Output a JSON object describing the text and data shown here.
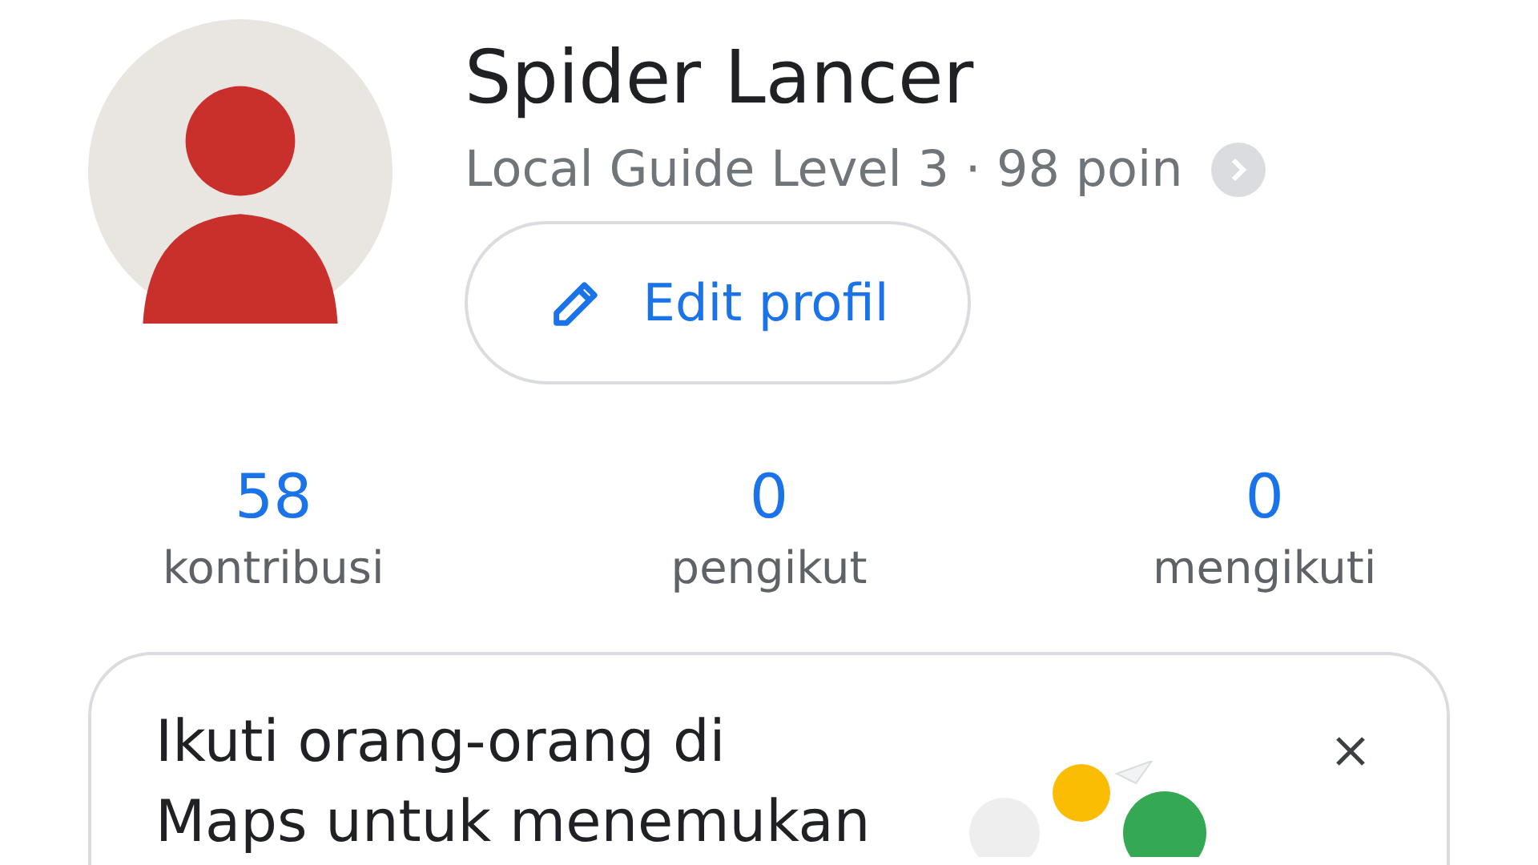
{
  "profile": {
    "name": "Spider Lancer",
    "subtitle": "Local Guide Level 3 · 98 poin",
    "edit_button": "Edit profil"
  },
  "stats": [
    {
      "value": "58",
      "label": "kontribusi"
    },
    {
      "value": "0",
      "label": "pengikut"
    },
    {
      "value": "0",
      "label": "mengikuti"
    }
  ],
  "card": {
    "text_lines": [
      "Ikuti orang-orang di",
      "Maps untuk menemukan"
    ]
  }
}
